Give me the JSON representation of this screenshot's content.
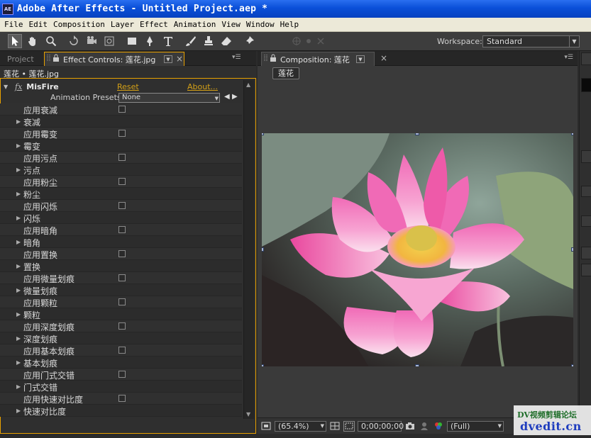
{
  "window": {
    "app_icon_label": "AE",
    "title": "Adobe After Effects - Untitled Project.aep *"
  },
  "menu": [
    "File",
    "Edit",
    "Composition",
    "Layer",
    "Effect",
    "Animation",
    "View",
    "Window",
    "Help"
  ],
  "toolbar": {
    "workspace_label": "Workspace:",
    "workspace_value": "Standard"
  },
  "left_panel": {
    "tab_project": "Project",
    "tab_effect_controls": "Effect Controls: 莲花.jpg",
    "layer_path": "莲花 • 莲花.jpg",
    "effect": {
      "fx_label": "fx",
      "name": "MisFire",
      "reset_label": "Reset",
      "about_label": "About...",
      "animation_presets_label": "Animation Presets:",
      "animation_presets_value": "None",
      "properties": [
        {
          "label": "应用衰减",
          "kind": "checkbox"
        },
        {
          "label": "衰减",
          "kind": "group"
        },
        {
          "label": "应用霉变",
          "kind": "checkbox"
        },
        {
          "label": "霉变",
          "kind": "group"
        },
        {
          "label": "应用污点",
          "kind": "checkbox"
        },
        {
          "label": "污点",
          "kind": "group"
        },
        {
          "label": "应用粉尘",
          "kind": "checkbox"
        },
        {
          "label": "粉尘",
          "kind": "group"
        },
        {
          "label": "应用闪烁",
          "kind": "checkbox"
        },
        {
          "label": "闪烁",
          "kind": "group"
        },
        {
          "label": "应用暗角",
          "kind": "checkbox"
        },
        {
          "label": "暗角",
          "kind": "group"
        },
        {
          "label": "应用置换",
          "kind": "checkbox"
        },
        {
          "label": "置换",
          "kind": "group"
        },
        {
          "label": "应用微量划痕",
          "kind": "checkbox"
        },
        {
          "label": "微量划痕",
          "kind": "group"
        },
        {
          "label": "应用颗粒",
          "kind": "checkbox"
        },
        {
          "label": "颗粒",
          "kind": "group"
        },
        {
          "label": "应用深度划痕",
          "kind": "checkbox"
        },
        {
          "label": "深度划痕",
          "kind": "group"
        },
        {
          "label": "应用基本划痕",
          "kind": "checkbox"
        },
        {
          "label": "基本划痕",
          "kind": "group"
        },
        {
          "label": "应用门式交错",
          "kind": "checkbox"
        },
        {
          "label": "门式交错",
          "kind": "group"
        },
        {
          "label": "应用快速对比度",
          "kind": "checkbox"
        },
        {
          "label": "快速对比度",
          "kind": "group"
        }
      ]
    }
  },
  "composition": {
    "tab_label": "Composition: 莲花",
    "breadcrumb": "莲花",
    "footer": {
      "zoom": "(65.4%)",
      "timecode": "0;00;00;00",
      "resolution": "(Full)"
    }
  },
  "watermark": {
    "line1": "DV视频剪辑论坛",
    "line2": "dvedit.cn"
  },
  "colors": {
    "accent": "#e8a100",
    "link": "#d4a017",
    "title_bar": "#0a4fd8"
  }
}
